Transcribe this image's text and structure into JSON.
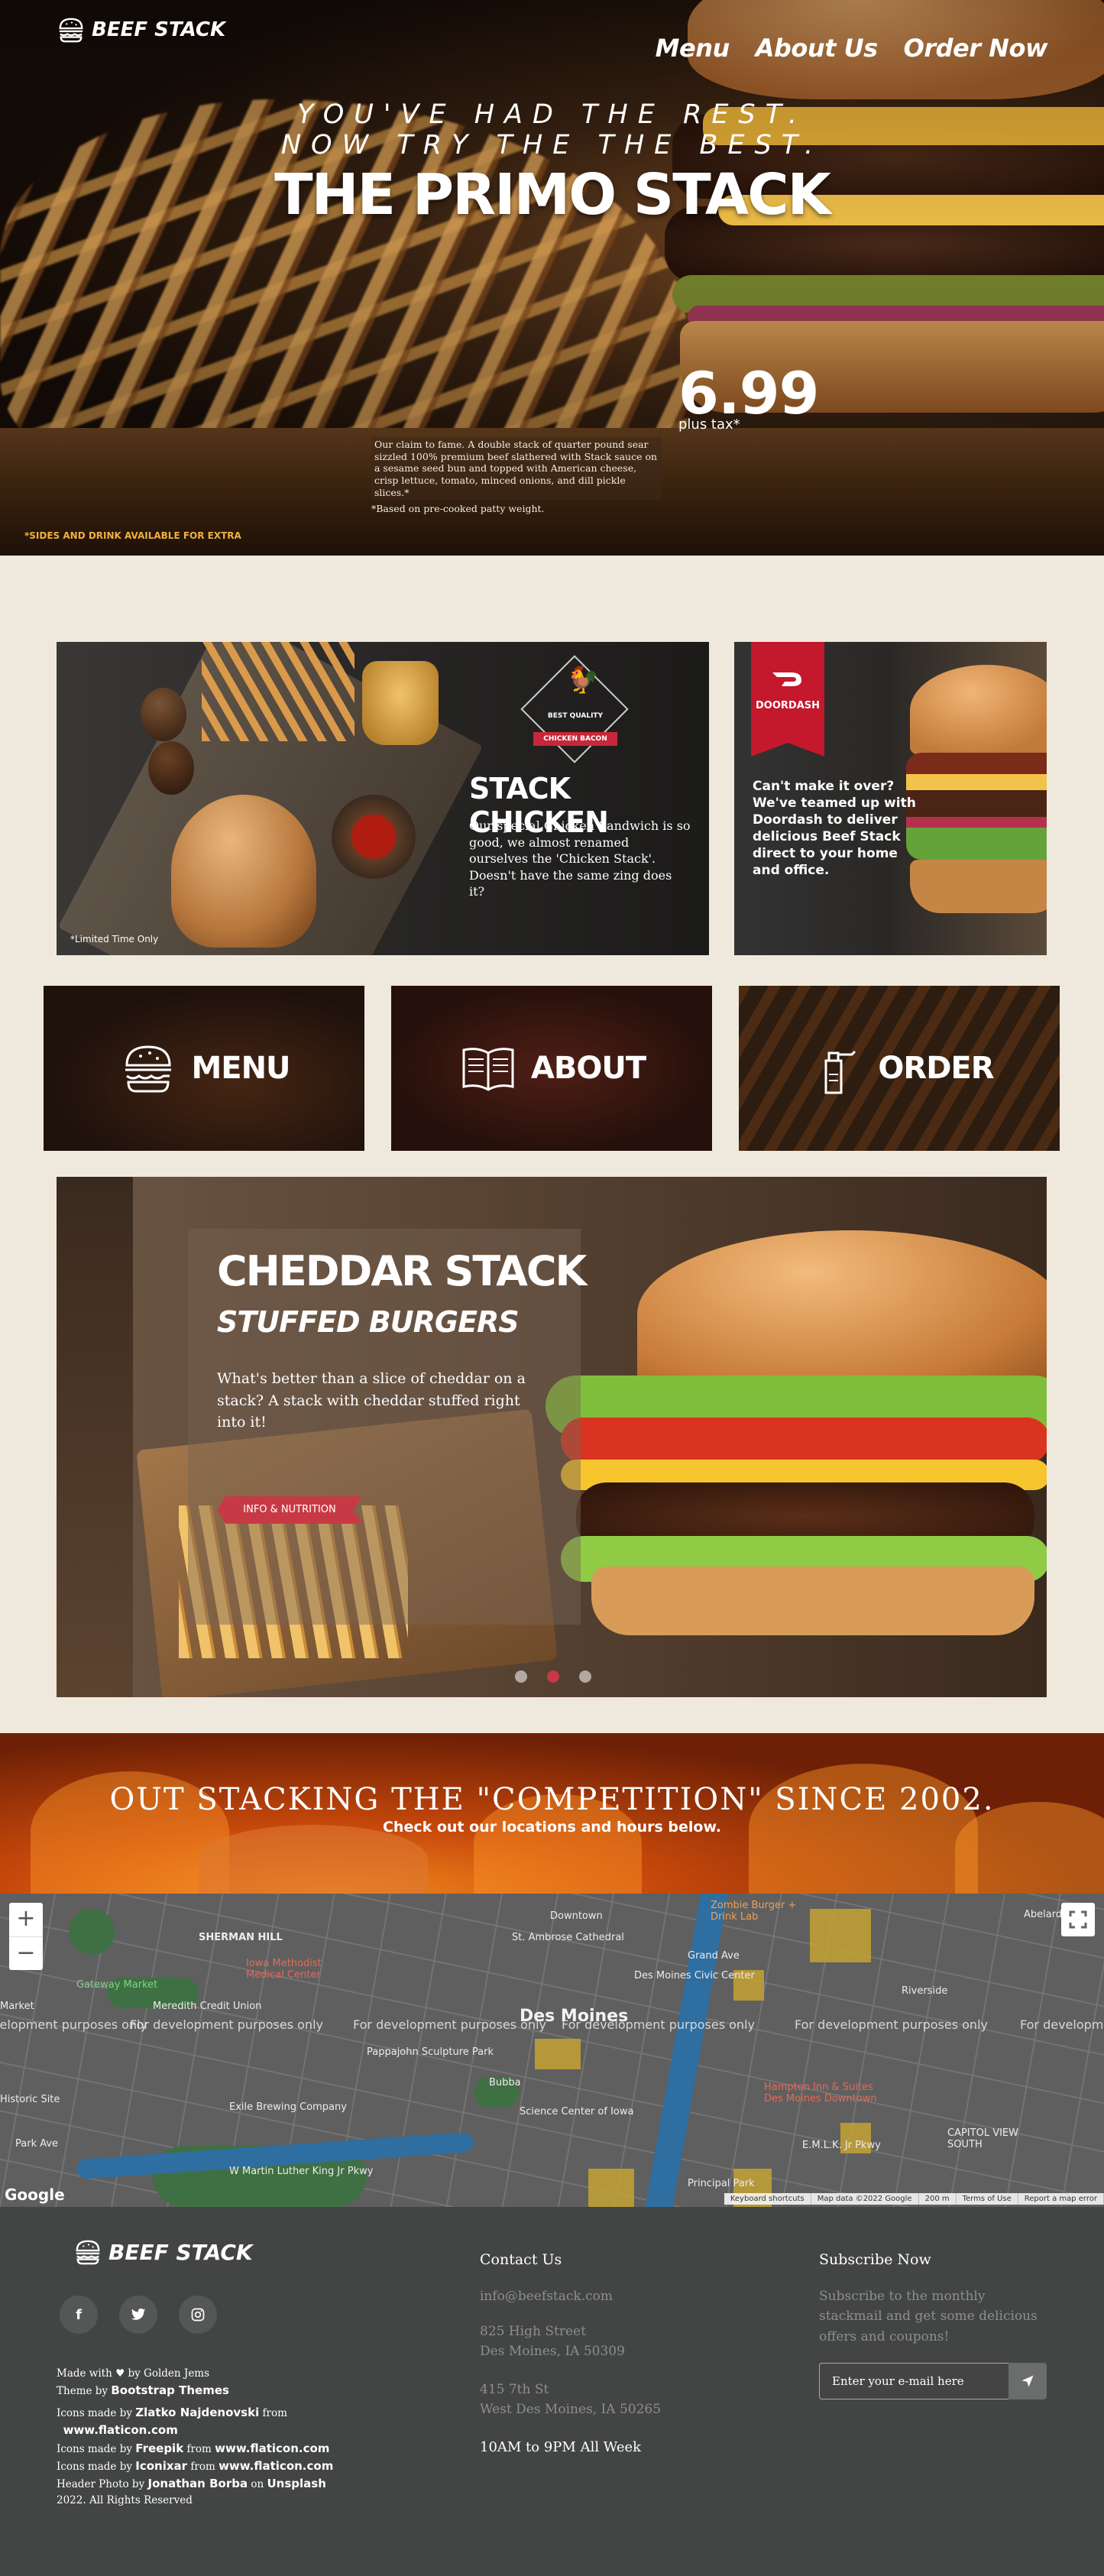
{
  "brand": {
    "name": "BEEF STACK"
  },
  "nav": {
    "menu": "Menu",
    "about": "About Us",
    "order": "Order Now"
  },
  "hero": {
    "tagline1": "YOU'VE HAD THE REST.",
    "tagline2": "NOW TRY THE THE BEST.",
    "title": "THE PRIMO STACK",
    "price": "6.99",
    "price_sub": "plus tax*",
    "description": "Our claim to fame. A double stack of quarter pound sear sizzled 100% premium beef slathered with Stack sauce on a sesame seed bun and topped with American cheese, crisp lettuce, tomato, minced onions, and dill pickle slices.*",
    "note": "*Based on pre-cooked patty weight.",
    "sides": "*SIDES AND DRINK AVAILABLE FOR EXTRA"
  },
  "chicken": {
    "badge_top": "BEST QUALITY",
    "badge_ribbon": "CHICKEN BACON",
    "title": "STACK CHICKEN",
    "description": "Our special Chicken Sandwich is so good, we almost renamed ourselves the 'Chicken Stack'. Doesn't have the same zing does it?",
    "limited": "*Limited Time Only"
  },
  "doordash": {
    "name": "DOORDASH",
    "text": "Can't make it over? We've teamed up with Doordash to deliver delicious Beef Stack direct to your home and office."
  },
  "tiles": {
    "menu": "MENU",
    "about": "ABOUT",
    "order": "ORDER"
  },
  "carousel": {
    "title1": "CHEDDAR STACK",
    "title2": "STUFFED BURGERS",
    "description": "What's better than a slice of cheddar on a stack? A stack with cheddar stuffed right into it!",
    "button": "INFO & NUTRITION",
    "slides": 3,
    "active_slide": 2
  },
  "banner": {
    "title": "OUT STACKING THE \"COMPETITION\" SINCE 2002.",
    "subtitle": "Check out our locations and hours below."
  },
  "map": {
    "city": "Des Moines",
    "dev_text": "For development purposes only",
    "labels": [
      "SHERMAN HILL",
      "Iowa Methodist Medical Center",
      "St. Ambrose Cathedral",
      "Des Moines Civic Center",
      "Zombie Burger + Drink Lab",
      "Pappajohn Sculpture Park",
      "Exile Brewing Company",
      "Science Center of Iowa",
      "Principal Park",
      "CAPITOL VIEW SOUTH",
      "Historic Site",
      "Gateway Market",
      "Meredith Credit Union",
      "Hampton Inn & Suites Des Moines Downtown",
      "Bubba",
      "Park Ave",
      "W Martin Luther King Jr Pkwy",
      "E.M.L.K. Jr Pkwy",
      "Abelardo's",
      "Downtown",
      "Riverside",
      "Grand Ave",
      "Market"
    ],
    "google": "Google",
    "attribution": [
      "Keyboard shortcuts",
      "Map data ©2022 Google",
      "200 m",
      "Terms of Use",
      "Report a map error"
    ],
    "zoom_in": "+",
    "zoom_out": "−"
  },
  "footer": {
    "made_with": "Made with",
    "by": "by Golden Jems",
    "theme_by": "Theme by",
    "theme": "Bootstrap Themes",
    "icons_by": "Icons made by",
    "from": "from",
    "icon_credits": [
      {
        "author": "Zlatko Najdenovski",
        "site": "www.flaticon.com"
      },
      {
        "author": "Freepik",
        "site": "www.flaticon.com"
      },
      {
        "author": "Iconixar",
        "site": "www.flaticon.com"
      }
    ],
    "photo_by": "Header Photo by",
    "photo_author": "Jonathan Borba",
    "on": "on",
    "photo_site": "Unsplash",
    "copyright": "2022. All Rights Reserved",
    "contact_title": "Contact Us",
    "email": "info@beefstack.com",
    "address1_line1": "825 High Street",
    "address1_line2": "Des Moines, IA 50309",
    "address2_line1": "415 7th St",
    "address2_line2": "West Des Moines, IA 50265",
    "hours": "10AM to 9PM All Week",
    "subscribe_title": "Subscribe Now",
    "subscribe_text": "Subscribe to the monthly stackmail and get some delicious offers and coupons!",
    "email_placeholder": "Enter your e-mail here"
  },
  "colors": {
    "accent_red": "#c73a45",
    "doordash_red": "#c4182c",
    "footer_bg": "#434444",
    "page_bg": "#efe8dd"
  },
  "icons": [
    "burger-logo-icon",
    "facebook-icon",
    "twitter-icon",
    "instagram-icon",
    "heart-icon",
    "send-icon",
    "fullscreen-icon",
    "menu-burger-icon",
    "book-icon",
    "sauce-bottle-icon",
    "chicken-icon",
    "doordash-icon"
  ]
}
